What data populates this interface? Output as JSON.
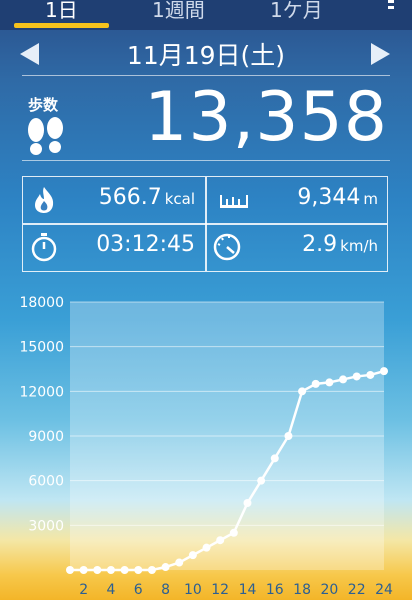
{
  "tabs": [
    {
      "label": "1日",
      "active": true
    },
    {
      "label": "1週間",
      "active": false
    },
    {
      "label": "1ケ月",
      "active": false
    }
  ],
  "date": "11月19日(土)",
  "steps": {
    "label": "歩数",
    "value": "13,358"
  },
  "stats": {
    "calories": {
      "value": "566.7",
      "unit": "kcal",
      "icon": "flame-icon"
    },
    "distance": {
      "value": "9,344",
      "unit": "m",
      "icon": "ruler-icon"
    },
    "duration": {
      "value": "03:12:45",
      "icon": "stopwatch-icon"
    },
    "speed": {
      "value": "2.9",
      "unit": "km/h",
      "icon": "speedometer-icon"
    }
  },
  "colors": {
    "accent": "#f6c21c",
    "header": "#1f3f73"
  },
  "chart_data": {
    "type": "line",
    "x": [
      1,
      2,
      3,
      4,
      5,
      6,
      7,
      8,
      9,
      10,
      11,
      12,
      13,
      14,
      15,
      16,
      17,
      18,
      19,
      20,
      21,
      22,
      23,
      24
    ],
    "values": [
      0,
      0,
      0,
      0,
      0,
      0,
      0,
      200,
      500,
      1000,
      1500,
      2000,
      2500,
      4500,
      6000,
      7500,
      9000,
      12000,
      12500,
      12600,
      12800,
      13000,
      13100,
      13358
    ],
    "x_tick_labels": [
      "2",
      "4",
      "6",
      "8",
      "10",
      "12",
      "14",
      "16",
      "18",
      "20",
      "22",
      "24"
    ],
    "y_tick_labels": [
      "3000",
      "6000",
      "9000",
      "12000",
      "15000",
      "18000"
    ],
    "ylim": [
      0,
      18000
    ],
    "xlim": [
      1,
      24
    ]
  }
}
